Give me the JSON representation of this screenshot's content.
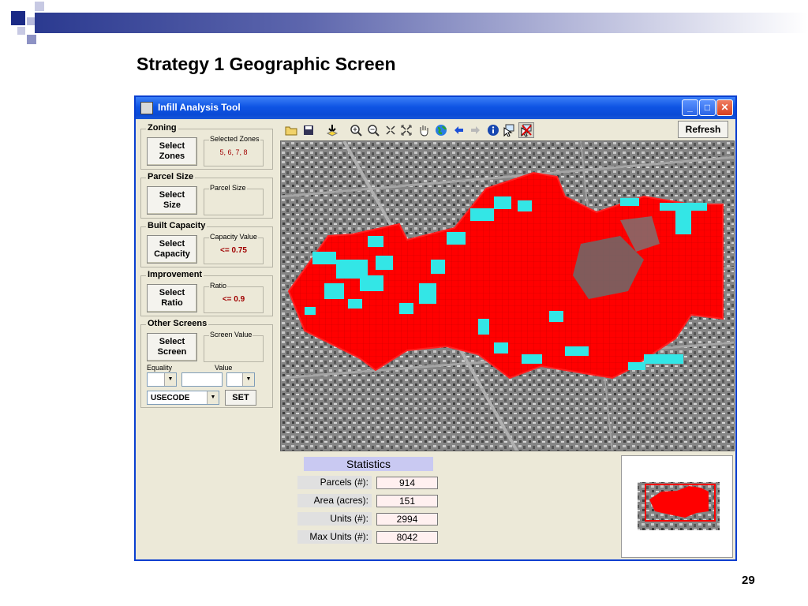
{
  "slide": {
    "title": "Strategy 1 Geographic Screen",
    "page_number": "29"
  },
  "window": {
    "title": "Infill Analysis Tool"
  },
  "left_panel": {
    "zoning": {
      "group_label": "Zoning",
      "button_label": "Select\nZones",
      "sub_label": "Selected Zones",
      "sub_value": "5, 6, 7, 8"
    },
    "parcel_size": {
      "group_label": "Parcel Size",
      "button_label": "Select\nSize",
      "sub_label": "Parcel Size",
      "sub_value": ""
    },
    "built_capacity": {
      "group_label": "Built Capacity",
      "button_label": "Select\nCapacity",
      "sub_label": "Capacity Value",
      "sub_value": "<= 0.75"
    },
    "improvement": {
      "group_label": "Improvement",
      "button_label": "Select\nRatio",
      "sub_label": "Ratio",
      "sub_value": "<= 0.9"
    },
    "other_screens": {
      "group_label": "Other Screens",
      "button_label": "Select\nScreen",
      "sub_label": "Screen Value",
      "sub_value": "",
      "equality_label": "Equality",
      "value_label": "Value",
      "field_combo": "USECODE",
      "set_label": "SET"
    }
  },
  "toolbar": {
    "refresh_label": "Refresh",
    "tools": [
      "open-folder-icon",
      "save-icon",
      "add-layer-icon",
      "zoom-in-icon",
      "zoom-out-icon",
      "zoom-fixed-in-icon",
      "full-extent-icon",
      "pan-hand-icon",
      "globe-icon",
      "back-arrow-icon",
      "forward-arrow-icon",
      "info-icon",
      "select-feature-icon",
      "clear-selection-icon"
    ]
  },
  "statistics": {
    "title": "Statistics",
    "rows": [
      {
        "label": "Parcels (#):",
        "value": "914"
      },
      {
        "label": "Area (acres):",
        "value": "151"
      },
      {
        "label": "Units (#):",
        "value": "2994"
      },
      {
        "label": "Max Units (#):",
        "value": "8042"
      }
    ]
  },
  "colors": {
    "selected_parcels": "#ff0000",
    "highlighted_parcels": "#33e6e6",
    "titlebar": "#0a4ad6",
    "stats_header": "#c9c9f2"
  }
}
